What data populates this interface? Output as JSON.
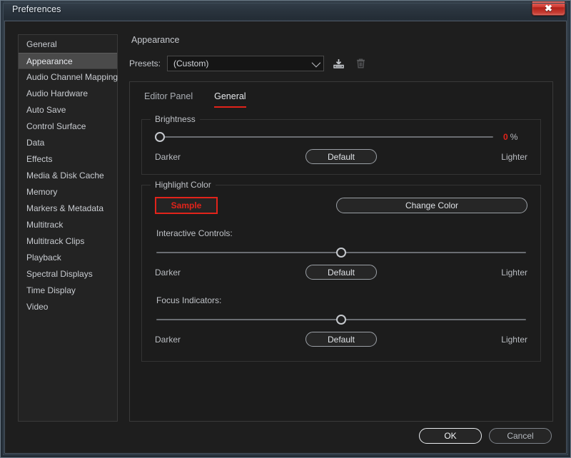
{
  "window": {
    "title": "Preferences",
    "close_label": "✕"
  },
  "sidebar": {
    "items": [
      {
        "label": "General",
        "selected": false
      },
      {
        "label": "Appearance",
        "selected": true
      },
      {
        "label": "Audio Channel Mapping",
        "selected": false
      },
      {
        "label": "Audio Hardware",
        "selected": false
      },
      {
        "label": "Auto Save",
        "selected": false
      },
      {
        "label": "Control Surface",
        "selected": false
      },
      {
        "label": "Data",
        "selected": false
      },
      {
        "label": "Effects",
        "selected": false
      },
      {
        "label": "Media & Disk Cache",
        "selected": false
      },
      {
        "label": "Memory",
        "selected": false
      },
      {
        "label": "Markers & Metadata",
        "selected": false
      },
      {
        "label": "Multitrack",
        "selected": false
      },
      {
        "label": "Multitrack Clips",
        "selected": false
      },
      {
        "label": "Playback",
        "selected": false
      },
      {
        "label": "Spectral Displays",
        "selected": false
      },
      {
        "label": "Time Display",
        "selected": false
      },
      {
        "label": "Video",
        "selected": false
      }
    ]
  },
  "pane": {
    "title": "Appearance",
    "presets": {
      "label": "Presets:",
      "selected": "(Custom)",
      "options": [
        "(Custom)"
      ],
      "save_icon": "save-preset-icon",
      "delete_icon": "delete-preset-icon"
    },
    "tabs": [
      {
        "label": "Editor Panel",
        "active": false
      },
      {
        "label": "General",
        "active": true
      }
    ],
    "brightness": {
      "legend": "Brightness",
      "value": 0,
      "value_unit": "%",
      "position_pct": 0,
      "left_label": "Darker",
      "right_label": "Lighter",
      "default_label": "Default"
    },
    "highlight": {
      "legend": "Highlight Color",
      "sample_label": "Sample",
      "sample_color": "#e2231a",
      "change_label": "Change Color",
      "interactive": {
        "label": "Interactive Controls:",
        "position_pct": 50,
        "left_label": "Darker",
        "right_label": "Lighter",
        "default_label": "Default"
      },
      "focus": {
        "label": "Focus Indicators:",
        "position_pct": 50,
        "left_label": "Darker",
        "right_label": "Lighter",
        "default_label": "Default"
      }
    }
  },
  "footer": {
    "ok_label": "OK",
    "cancel_label": "Cancel"
  }
}
